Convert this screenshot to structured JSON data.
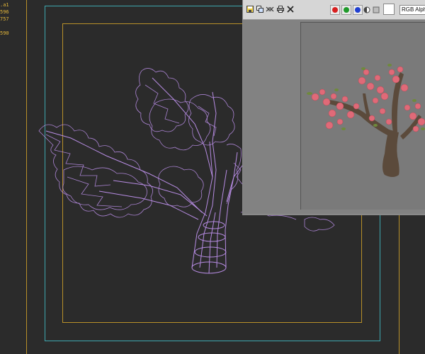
{
  "viewport": {
    "stats": [
      ".a1",
      "596",
      "757",
      "",
      "590"
    ],
    "colors": {
      "wire": "#b78ce3",
      "background": "#2b2b2b",
      "safe_frame_outer": "#3ea9b0",
      "safe_frame_inner": "#b8902a"
    }
  },
  "render_window": {
    "toolbar": {
      "icons": [
        "save-image-icon",
        "copy-image-icon",
        "clone-window-icon",
        "print-icon",
        "clear-icon"
      ],
      "channels": [
        "red",
        "green",
        "blue"
      ],
      "channel_select": "RGB Alpha"
    },
    "preview": {
      "subject": "blossom tree",
      "colors": {
        "trunk": "#5a4a3a",
        "blossom": "#e06a78",
        "leaf": "#6f8a3c"
      }
    }
  }
}
